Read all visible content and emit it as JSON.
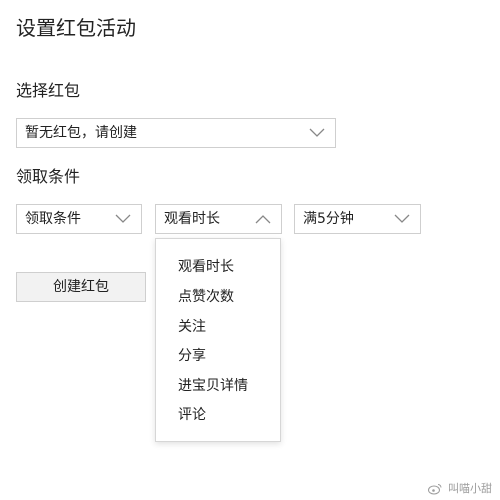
{
  "page": {
    "title": "设置红包活动"
  },
  "red_packet_section": {
    "label": "选择红包",
    "select_value": "暂无红包，请创建"
  },
  "conditions_section": {
    "label": "领取条件",
    "select_condition": "领取条件",
    "select_type": "观看时长",
    "select_duration": "满5分钟"
  },
  "create_button": {
    "label": "创建红包"
  },
  "dropdown_menu": {
    "items": [
      "观看时长",
      "点赞次数",
      "关注",
      "分享",
      "进宝贝详情",
      "评论"
    ]
  },
  "watermark": {
    "text": "叫喵小甜"
  },
  "icons": {
    "chevron_down": "chevron-down-icon",
    "chevron_up": "chevron-up-icon",
    "weibo": "weibo-logo-icon"
  },
  "colors": {
    "border": "#cfcfcf",
    "chevron": "#888888",
    "button_bg": "#f2f2f2",
    "text": "#222222"
  }
}
